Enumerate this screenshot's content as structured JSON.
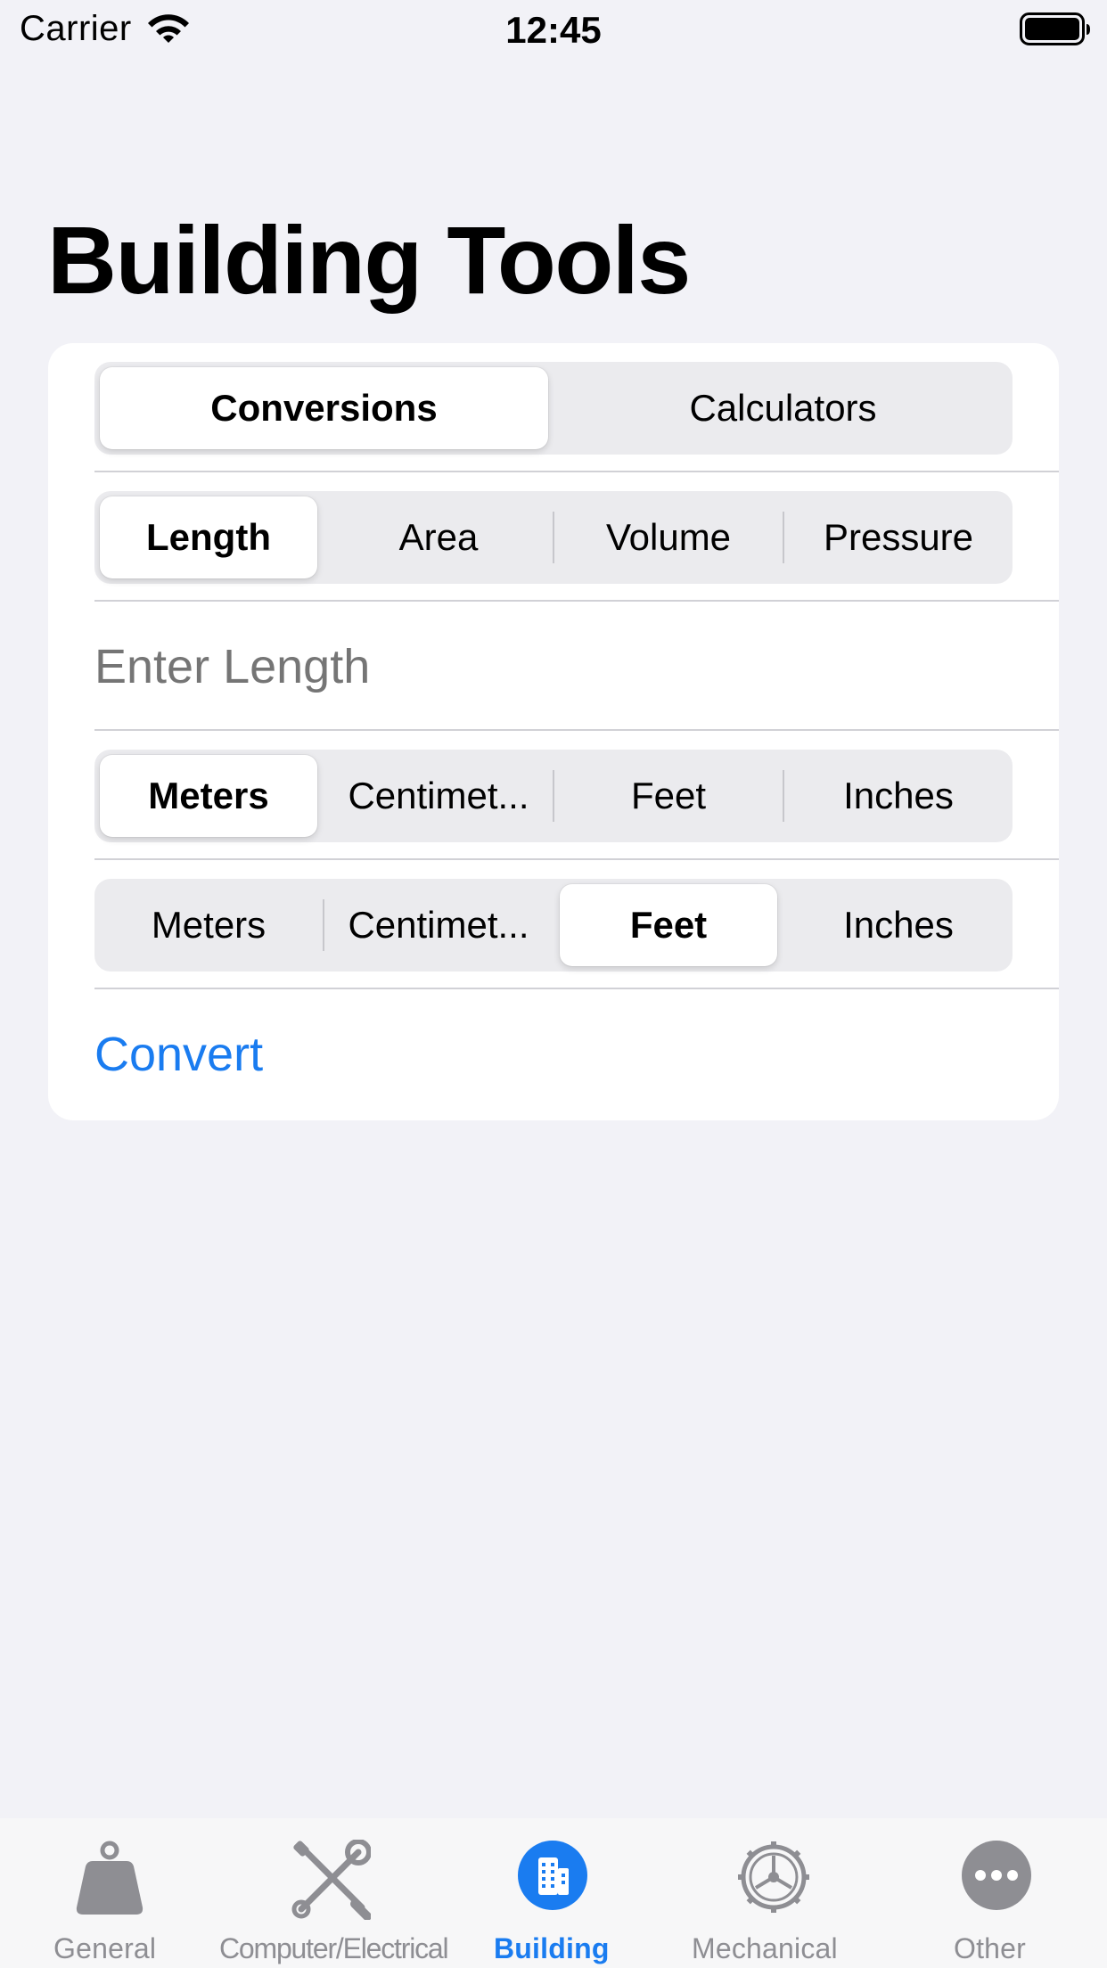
{
  "status_bar": {
    "carrier": "Carrier",
    "time": "12:45",
    "icons": [
      "wifi-icon",
      "battery-icon"
    ]
  },
  "page": {
    "title": "Building Tools"
  },
  "mode_segment": {
    "options": [
      "Conversions",
      "Calculators"
    ],
    "selected": "Conversions"
  },
  "category_segment": {
    "options": [
      "Length",
      "Area",
      "Volume",
      "Pressure"
    ],
    "selected": "Length"
  },
  "input": {
    "placeholder": "Enter Length",
    "value": ""
  },
  "from_unit_segment": {
    "options": [
      "Meters",
      "Centimet...",
      "Feet",
      "Inches"
    ],
    "selected": "Meters"
  },
  "to_unit_segment": {
    "options": [
      "Meters",
      "Centimet...",
      "Feet",
      "Inches"
    ],
    "selected": "Feet"
  },
  "actions": {
    "convert_label": "Convert"
  },
  "tab_bar": {
    "items": [
      {
        "label": "General",
        "icon": "weight-icon"
      },
      {
        "label": "Computer/Electrical",
        "icon": "wrench-screwdriver-icon"
      },
      {
        "label": "Building",
        "icon": "building-icon"
      },
      {
        "label": "Mechanical",
        "icon": "gear-icon"
      },
      {
        "label": "Other",
        "icon": "more-icon"
      }
    ],
    "active": "Building"
  },
  "colors": {
    "background": "#F2F2F7",
    "card": "#FFFFFF",
    "accent": "#1A7CF0",
    "inactive_tab": "#8E8E93",
    "placeholder": "#C4C4C6"
  }
}
